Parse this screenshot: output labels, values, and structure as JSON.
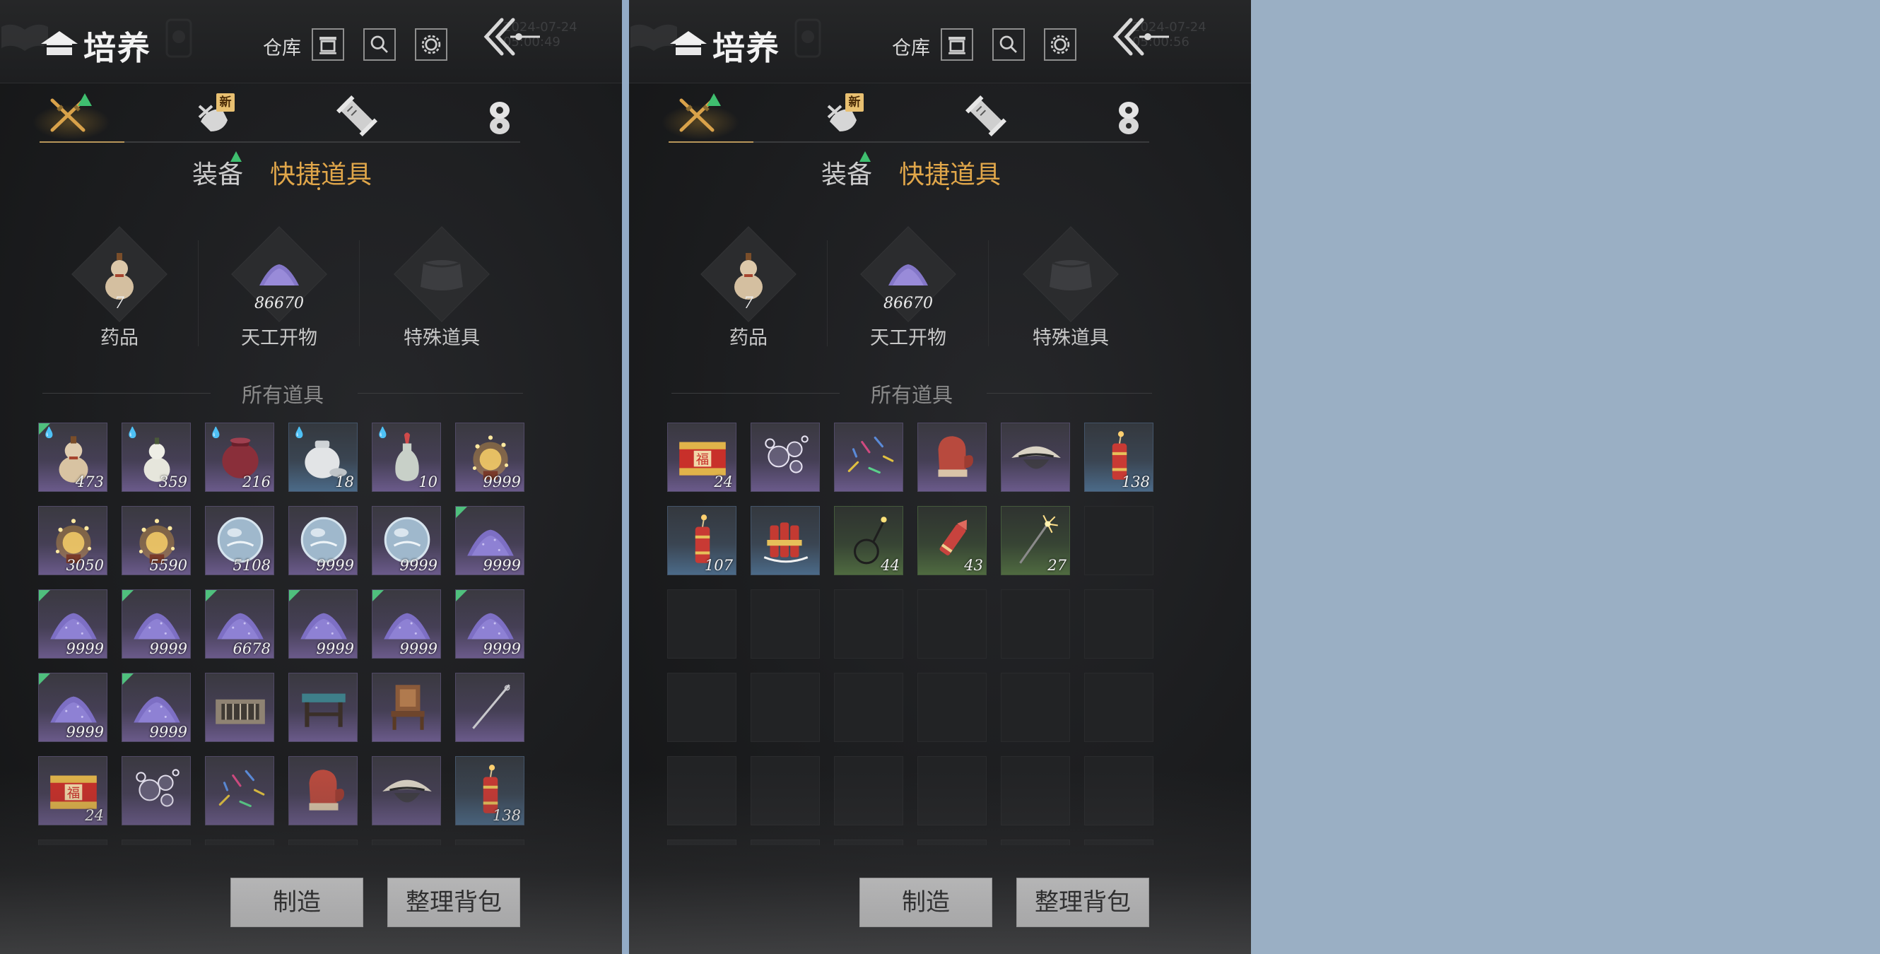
{
  "screens": [
    {
      "header": {
        "title": "培养",
        "warehouse_label": "仓库",
        "background_time": "2024-07-24 05:00:49"
      },
      "sub_tabs": {
        "equipment": "装备",
        "quick_items": "快捷道具"
      },
      "quick_slots": [
        {
          "label": "药品",
          "count": "7"
        },
        {
          "label": "天工开物",
          "count": "86670"
        },
        {
          "label": "特殊道具",
          "count": ""
        }
      ],
      "section_title": "所有道具",
      "items": [
        {
          "icon": "gourd-icon",
          "count": "473",
          "rarity": "purple",
          "corner": true,
          "drop": true
        },
        {
          "icon": "white-gourd-icon",
          "count": "359",
          "rarity": "purple",
          "corner": false,
          "drop": true
        },
        {
          "icon": "wine-jar-icon",
          "count": "216",
          "rarity": "purple",
          "corner": false,
          "drop": true
        },
        {
          "icon": "porcelain-jar-icon",
          "count": "18",
          "rarity": "blue",
          "corner": false,
          "drop": true
        },
        {
          "icon": "vase-icon",
          "count": "10",
          "rarity": "purple",
          "corner": false,
          "drop": true
        },
        {
          "icon": "firework-burst-icon",
          "count": "9999",
          "rarity": "purple",
          "corner": false,
          "drop": false
        },
        {
          "icon": "firework-burst-icon",
          "count": "3050",
          "rarity": "purple",
          "corner": false,
          "drop": false
        },
        {
          "icon": "firework-burst-icon",
          "count": "5590",
          "rarity": "purple",
          "corner": false,
          "drop": false
        },
        {
          "icon": "crystal-orb-icon",
          "count": "5108",
          "rarity": "purple",
          "corner": false,
          "drop": false
        },
        {
          "icon": "crystal-orb-icon",
          "count": "9999",
          "rarity": "purple",
          "corner": false,
          "drop": false
        },
        {
          "icon": "crystal-orb-icon",
          "count": "9999",
          "rarity": "purple",
          "corner": false,
          "drop": false
        },
        {
          "icon": "purple-powder-icon",
          "count": "9999",
          "rarity": "purple",
          "corner": true,
          "drop": false
        },
        {
          "icon": "purple-powder-icon",
          "count": "9999",
          "rarity": "purple",
          "corner": true,
          "drop": false
        },
        {
          "icon": "purple-powder-icon",
          "count": "9999",
          "rarity": "purple",
          "corner": true,
          "drop": false
        },
        {
          "icon": "purple-powder-icon",
          "count": "6678",
          "rarity": "purple",
          "corner": true,
          "drop": false
        },
        {
          "icon": "purple-powder-icon",
          "count": "9999",
          "rarity": "purple",
          "corner": true,
          "drop": false
        },
        {
          "icon": "purple-powder-icon",
          "count": "9999",
          "rarity": "purple",
          "corner": true,
          "drop": false
        },
        {
          "icon": "purple-powder-icon",
          "count": "9999",
          "rarity": "purple",
          "corner": true,
          "drop": false
        },
        {
          "icon": "purple-powder-icon",
          "count": "9999",
          "rarity": "purple",
          "corner": true,
          "drop": false
        },
        {
          "icon": "purple-powder-icon",
          "count": "9999",
          "rarity": "purple",
          "corner": true,
          "drop": false
        },
        {
          "icon": "wooden-frame-icon",
          "count": "",
          "rarity": "purple",
          "corner": false,
          "drop": false
        },
        {
          "icon": "table-icon",
          "count": "",
          "rarity": "purple",
          "corner": false,
          "drop": false
        },
        {
          "icon": "chair-icon",
          "count": "",
          "rarity": "purple",
          "corner": false,
          "drop": false
        },
        {
          "icon": "needle-icon",
          "count": "",
          "rarity": "purple",
          "corner": false,
          "drop": false
        },
        {
          "icon": "firecracker-box-icon",
          "count": "24",
          "rarity": "purple",
          "corner": false,
          "drop": false
        },
        {
          "icon": "bubbles-icon",
          "count": "",
          "rarity": "purple",
          "corner": false,
          "drop": false
        },
        {
          "icon": "confetti-icon",
          "count": "",
          "rarity": "purple",
          "corner": false,
          "drop": false
        },
        {
          "icon": "mitten-icon",
          "count": "",
          "rarity": "purple",
          "corner": false,
          "drop": false
        },
        {
          "icon": "straw-hat-icon",
          "count": "",
          "rarity": "purple",
          "corner": false,
          "drop": false
        },
        {
          "icon": "firecracker-icon",
          "count": "138",
          "rarity": "blue",
          "corner": false,
          "drop": false
        }
      ],
      "buttons": {
        "craft": "制造",
        "sort": "整理背包"
      }
    },
    {
      "header": {
        "title": "培养",
        "warehouse_label": "仓库",
        "background_time": "2024-07-24 05:00:56"
      },
      "sub_tabs": {
        "equipment": "装备",
        "quick_items": "快捷道具"
      },
      "quick_slots": [
        {
          "label": "药品",
          "count": "7"
        },
        {
          "label": "天工开物",
          "count": "86670"
        },
        {
          "label": "特殊道具",
          "count": ""
        }
      ],
      "section_title": "所有道具",
      "items": [
        {
          "icon": "firecracker-box-icon",
          "count": "24",
          "rarity": "purple",
          "corner": false,
          "drop": false
        },
        {
          "icon": "bubbles-icon",
          "count": "",
          "rarity": "purple",
          "corner": false,
          "drop": false
        },
        {
          "icon": "confetti-icon",
          "count": "",
          "rarity": "purple",
          "corner": false,
          "drop": false
        },
        {
          "icon": "mitten-icon",
          "count": "",
          "rarity": "purple",
          "corner": false,
          "drop": false
        },
        {
          "icon": "straw-hat-icon",
          "count": "",
          "rarity": "purple",
          "corner": false,
          "drop": false
        },
        {
          "icon": "firecracker-icon",
          "count": "138",
          "rarity": "blue",
          "corner": false,
          "drop": false
        },
        {
          "icon": "firecracker-icon",
          "count": "107",
          "rarity": "blue",
          "corner": false,
          "drop": false
        },
        {
          "icon": "firecracker-bundle-icon",
          "count": "",
          "rarity": "blue",
          "corner": false,
          "drop": false
        },
        {
          "icon": "sparkler-ring-icon",
          "count": "44",
          "rarity": "green",
          "corner": false,
          "drop": false
        },
        {
          "icon": "rocket-icon",
          "count": "43",
          "rarity": "green",
          "corner": false,
          "drop": false
        },
        {
          "icon": "sparkler-icon",
          "count": "27",
          "rarity": "green",
          "corner": false,
          "drop": false
        }
      ],
      "buttons": {
        "craft": "制造",
        "sort": "整理背包"
      }
    }
  ],
  "colors": {
    "background": "#9aafc4",
    "panel": "#1c1d1f",
    "accent_gold": "#e0a64a",
    "new_badge": "#e8c071",
    "up_arrow_green": "#3fbf6f",
    "rarity_purple": "#6a5a8a",
    "rarity_blue": "#4b6a88",
    "rarity_green": "#4f6a40"
  },
  "tab_icons": [
    "crossed-swords-icon",
    "bundle-new-icon",
    "scroll-icon",
    "coin-stack-icon"
  ],
  "new_badge_label": "新"
}
